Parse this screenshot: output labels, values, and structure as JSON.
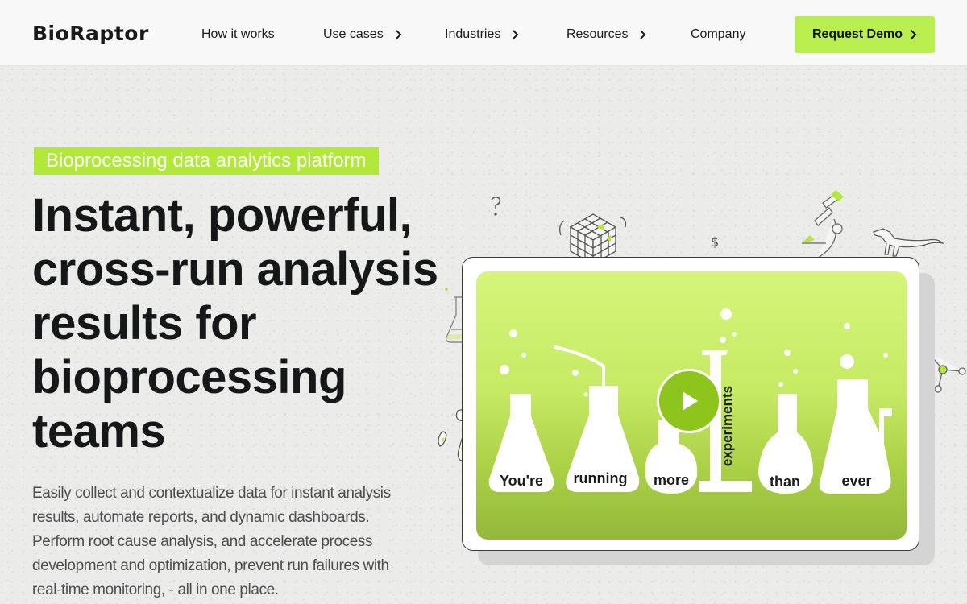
{
  "brand": {
    "name": "BioRaptor"
  },
  "nav": {
    "items": [
      {
        "label": "How it works",
        "has_submenu": false
      },
      {
        "label": "Use cases",
        "has_submenu": true
      },
      {
        "label": "Industries",
        "has_submenu": true
      },
      {
        "label": "Resources",
        "has_submenu": true
      },
      {
        "label": "Company",
        "has_submenu": false
      }
    ],
    "cta_label": "Request Demo"
  },
  "hero": {
    "tagline": "Bioprocessing data analytics platform",
    "headline_lines": [
      "Instant, powerful,",
      "cross-run analysis",
      "results for",
      "bioprocessing",
      "teams"
    ],
    "description_lines": [
      "Easily collect and contextualize data for instant analysis",
      "results, automate reports, and dynamic dashboards.",
      "Perform root cause analysis, and accelerate process",
      "development and optimization, prevent run failures with",
      "real-time monitoring, - all in one place."
    ]
  },
  "video": {
    "flask_words": [
      "You're",
      "running",
      "more",
      "experiments",
      "than",
      "ever"
    ]
  },
  "colors": {
    "accent": "#b9ee4f",
    "tagline_bg": "#b2e83a",
    "play_button": "#8dc51c",
    "text_dark": "#161718",
    "text_body": "#4c4d4f"
  },
  "icons": [
    "chevron-right-icon",
    "play-icon",
    "rubiks-cube-icon",
    "microscope-icon",
    "dinosaur-icon",
    "question-mark-icon",
    "dollar-icon",
    "molecule-icon",
    "flask-icon",
    "bacteria-icon"
  ]
}
